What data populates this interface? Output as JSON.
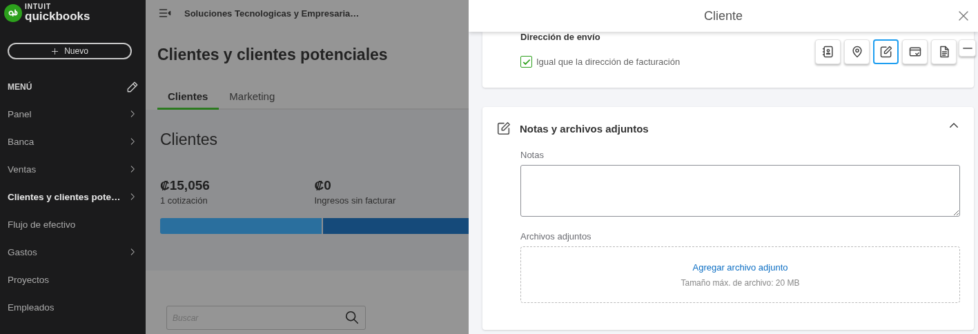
{
  "sidebar": {
    "logo": {
      "brand_top": "INTUIT",
      "brand": "quickbooks"
    },
    "new_button": "Nuevo",
    "menu_heading": "MENÚ",
    "items": [
      {
        "label": "Panel",
        "has_submenu": true,
        "selected": false
      },
      {
        "label": "Banca",
        "has_submenu": true,
        "selected": false
      },
      {
        "label": "Ventas",
        "has_submenu": true,
        "selected": false
      },
      {
        "label": "Clientes y clientes pote…",
        "has_submenu": true,
        "selected": true
      },
      {
        "label": "Flujo de efectivo",
        "has_submenu": false,
        "selected": false
      },
      {
        "label": "Gastos",
        "has_submenu": true,
        "selected": false
      },
      {
        "label": "Proyectos",
        "has_submenu": false,
        "selected": false
      },
      {
        "label": "Empleados",
        "has_submenu": false,
        "selected": false
      }
    ]
  },
  "main": {
    "company": "Soluciones Tecnologicas y Empresaria…",
    "title": "Clientes y clientes potenciales",
    "tabs": [
      {
        "label": "Clientes",
        "selected": true
      },
      {
        "label": "Marketing",
        "selected": false
      }
    ],
    "section_title": "Clientes",
    "stats": [
      {
        "amount": "₡15,056",
        "caption": "1 cotización",
        "color": "#2a6f9e"
      },
      {
        "amount": "₡0",
        "caption": "Ingresos sin facturar",
        "color": "#154a7a"
      }
    ],
    "search": {
      "placeholder": "Buscar"
    }
  },
  "drawer": {
    "title": "Cliente",
    "shipping": {
      "heading": "Dirección de envío",
      "same_as_billing": {
        "label": "Igual que la dirección de facturación",
        "checked": true
      }
    },
    "toolbar": [
      {
        "kind": "contact",
        "selected": false
      },
      {
        "kind": "location",
        "selected": false
      },
      {
        "kind": "notes",
        "selected": true
      },
      {
        "kind": "payment",
        "selected": false
      },
      {
        "kind": "document",
        "selected": false
      },
      {
        "kind": "minimize",
        "selected": false
      }
    ],
    "notes_section": {
      "title": "Notas y archivos adjuntos",
      "expanded": true,
      "notes_label": "Notas",
      "attachments_label": "Archivos adjuntos",
      "add_link": "Agregar archivo adjunto",
      "size_hint": "Tamaño máx. de archivo: 20 MB"
    }
  }
}
